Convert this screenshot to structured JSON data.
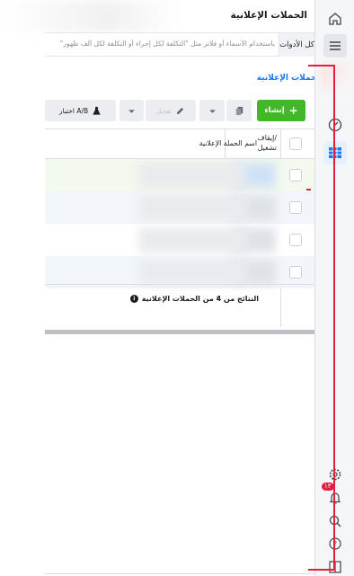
{
  "header": {
    "title": "الحملات الإعلانية"
  },
  "search": {
    "tools_label": "كل الأدوات",
    "placeholder": "باستخدام الأسماء أو فلاتر مثل \"التكلفة لكل إجراء أو التكلفة لكل ألف ظهور\""
  },
  "breadcrumb": {
    "label": "الحملات الإعلانية"
  },
  "toolbar": {
    "create_label": "إنشاء",
    "edit_label": "تعديل",
    "ab_test_label": "اختبار A/B"
  },
  "table": {
    "col_toggle": [
      "إيقاف/",
      "تشغيل"
    ],
    "col_name": "اسم الحملة الإعلانية",
    "footer": "النتائج من 4 من الحملات الإعلانية",
    "info_icon": "i"
  },
  "rail": {
    "notification_badge": "١٣"
  },
  "colors": {
    "accent": "#1877f2",
    "create": "#42b72a",
    "highlight": "#e41e3f"
  }
}
